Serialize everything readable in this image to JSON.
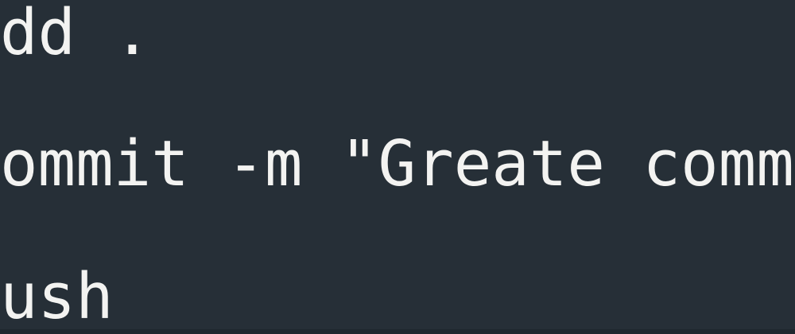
{
  "terminal": {
    "lines": [
      "dd .",
      "ommit -m \"Greate commit m",
      "ush"
    ]
  },
  "colors": {
    "background": "#262f37",
    "text": "#f3f3f1"
  }
}
